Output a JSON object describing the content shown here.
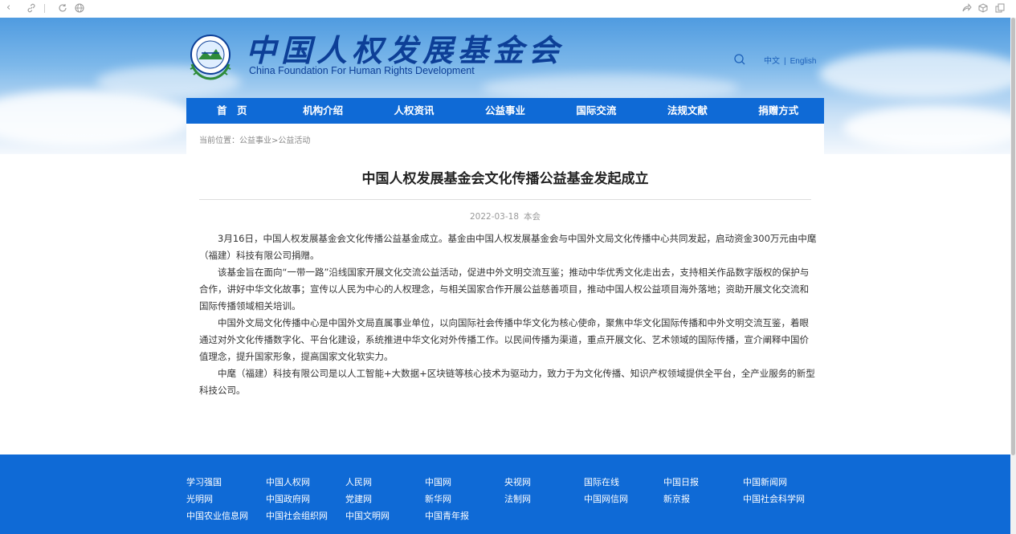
{
  "browser": {
    "icons": [
      "back-icon",
      "link-icon",
      "refresh-icon",
      "globe-icon",
      "share-icon",
      "cube-icon",
      "copy-icon"
    ]
  },
  "header": {
    "logo_cn": "中国人权发展基金会",
    "logo_en": "China Foundation For Human Rights Development",
    "lang_cn": "中文",
    "lang_sep": "|",
    "lang_en": "English"
  },
  "nav": {
    "items": [
      "首　页",
      "机构介绍",
      "人权资讯",
      "公益事业",
      "国际交流",
      "法规文献",
      "捐赠方式"
    ]
  },
  "breadcrumb": "当前位置：公益事业>公益活动",
  "article": {
    "title": "中国人权发展基金会文化传播公益基金发起成立",
    "date": "2022-03-18",
    "source": "本会",
    "paragraphs": [
      "3月16日，中国人权发展基金会文化传播公益基金成立。基金由中国人权发展基金会与中国外文局文化传播中心共同发起，启动资金300万元由中麾（福建）科技有限公司捐赠。",
      "该基金旨在面向“一带一路”沿线国家开展文化交流公益活动，促进中外文明交流互鉴；推动中华优秀文化走出去，支持相关作品数字版权的保护与合作，讲好中华文化故事；宣传以人民为中心的人权理念，与相关国家合作开展公益慈善项目，推动中国人权公益项目海外落地；资助开展文化交流和国际传播领域相关培训。",
      "中国外文局文化传播中心是中国外文局直属事业单位，以向国际社会传播中华文化为核心使命，聚焦中华文化国际传播和中外文明交流互鉴，着眼通过对外文化传播数字化、平台化建设，系统推进中华文化对外传播工作。以民间传播为渠道，重点开展文化、艺术领域的国际传播，宣介阐释中国价值理念，提升国家形象，提高国家文化软实力。",
      "中麾（福建）科技有限公司是以人工智能+大数据+区块链等核心技术为驱动力，致力于为文化传播、知识产权领域提供全平台，全产业服务的新型科技公司。"
    ]
  },
  "footer": {
    "links": [
      "学习强国",
      "中国人权网",
      "人民网",
      "中国网",
      "央视网",
      "国际在线",
      "中国日报",
      "中国新闻网",
      "光明网",
      "中国政府网",
      "党建网",
      "新华网",
      "法制网",
      "中国网信网",
      "新京报",
      "中国社会科学网",
      "中国农业信息网",
      "中国社会组织网",
      "中国文明网",
      "中国青年报"
    ]
  },
  "colors": {
    "nav_bg": "#0f6ad6",
    "footer_bg": "#0f6ad6",
    "logo_blue": "#0d3f97"
  }
}
